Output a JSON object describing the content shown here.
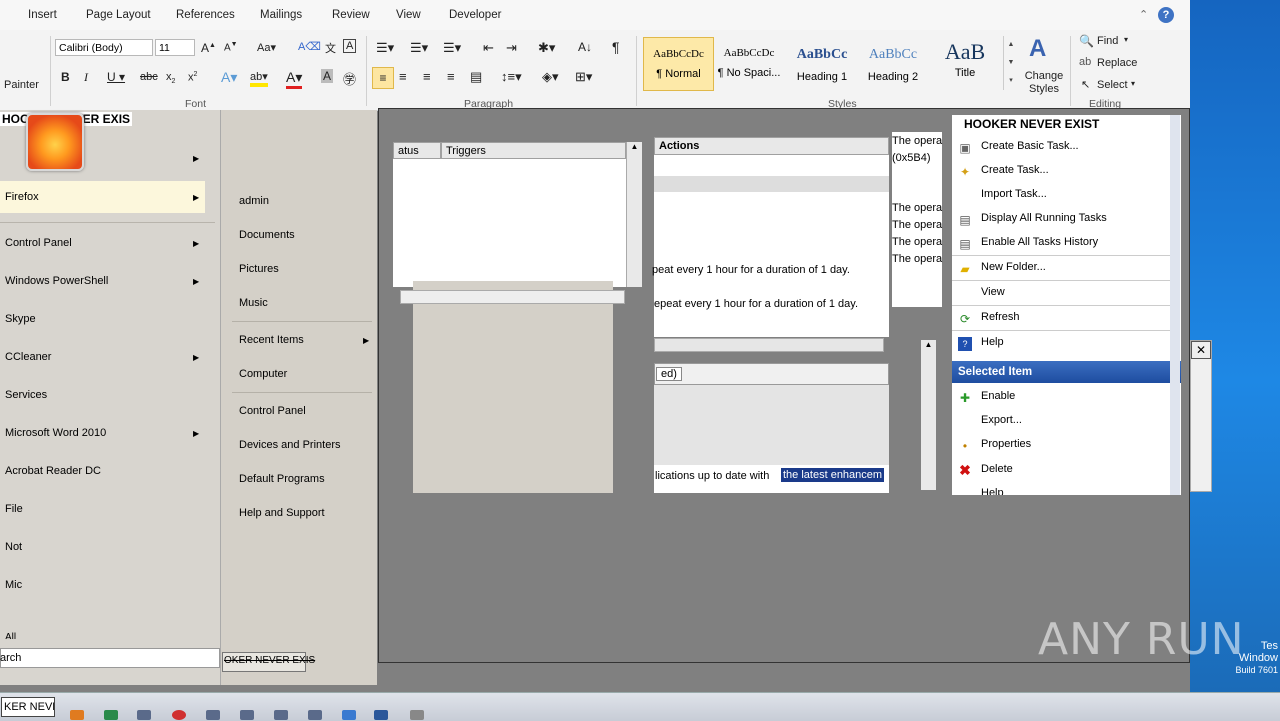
{
  "ribbon": {
    "tabs": [
      "Insert",
      "Page Layout",
      "References",
      "Mailings",
      "Review",
      "View",
      "Developer"
    ],
    "clipboard": {
      "format_painter": "Painter"
    },
    "font": {
      "name": "Calibri (Body)",
      "size": "11",
      "group_label": "Font"
    },
    "paragraph": {
      "group_label": "Paragraph"
    },
    "styles": {
      "group_label": "Styles",
      "items": [
        {
          "preview": "AaBbCcDc",
          "name": "¶ Normal"
        },
        {
          "preview": "AaBbCcDc",
          "name": "¶ No Spaci..."
        },
        {
          "preview": "AaBbCc",
          "name": "Heading 1"
        },
        {
          "preview": "AaBbCc",
          "name": "Heading 2"
        },
        {
          "preview": "AaB",
          "name": "Title"
        }
      ],
      "change_styles": "Change Styles"
    },
    "editing": {
      "group_label": "Editing",
      "find": "Find",
      "replace": "Replace",
      "select": "Select"
    }
  },
  "task_scheduler": {
    "columns": {
      "status": "atus",
      "triggers": "Triggers",
      "actions": "Actions"
    },
    "trigger_lines": [
      "peat every 1 hour for a duration of 1 day.",
      "epeat every 1 hour for a duration of 1 day."
    ],
    "tab_fragment": "ed)",
    "description": "lications up to date with",
    "description_highlight": "the latest enhancem",
    "history_lines": [
      "The opera",
      "(0x5B4)",
      "The opera",
      "The opera",
      "The opera",
      "The opera"
    ],
    "overlay_title": "HOOKER NEVER EXIST",
    "actions_pane": {
      "items": [
        "Create Basic Task...",
        "Create Task...",
        "Import Task...",
        "Display All Running Tasks",
        "Enable All Tasks History",
        "New Folder...",
        "View",
        "Refresh",
        "Help"
      ],
      "selected_header": "Selected Item",
      "selected_items": [
        "Enable",
        "Export...",
        "Properties",
        "Delete",
        "Help"
      ]
    }
  },
  "start_menu": {
    "overlay_title": "HOOKER NEVER EXIS",
    "programs": [
      "Firefox",
      "Control Panel",
      "Windows PowerShell",
      "Skype",
      "CCleaner",
      "Services",
      "Microsoft Word 2010",
      "Acrobat Reader DC",
      "File",
      "Not",
      "Mic",
      "All"
    ],
    "search_fragment": "arch",
    "right_items": [
      "admin",
      "Documents",
      "Pictures",
      "Music",
      "Recent Items",
      "Computer",
      "Control Panel",
      "Devices and Printers",
      "Default Programs",
      "Help and Support"
    ],
    "shutdown_label": "OKER NEVER EXIS"
  },
  "taskbar": {
    "start_label": "KER NEVE"
  },
  "watermark": {
    "text": "ANY RUN"
  },
  "desktop": {
    "corner_lines": [
      "Tes",
      "Window",
      "Build 7601"
    ]
  },
  "colors": {
    "ribbon_bg": "#f3f3f3",
    "actions_header": "#1e4da0",
    "desktop": "#1e88e5",
    "selection": "#1a3a8a"
  }
}
